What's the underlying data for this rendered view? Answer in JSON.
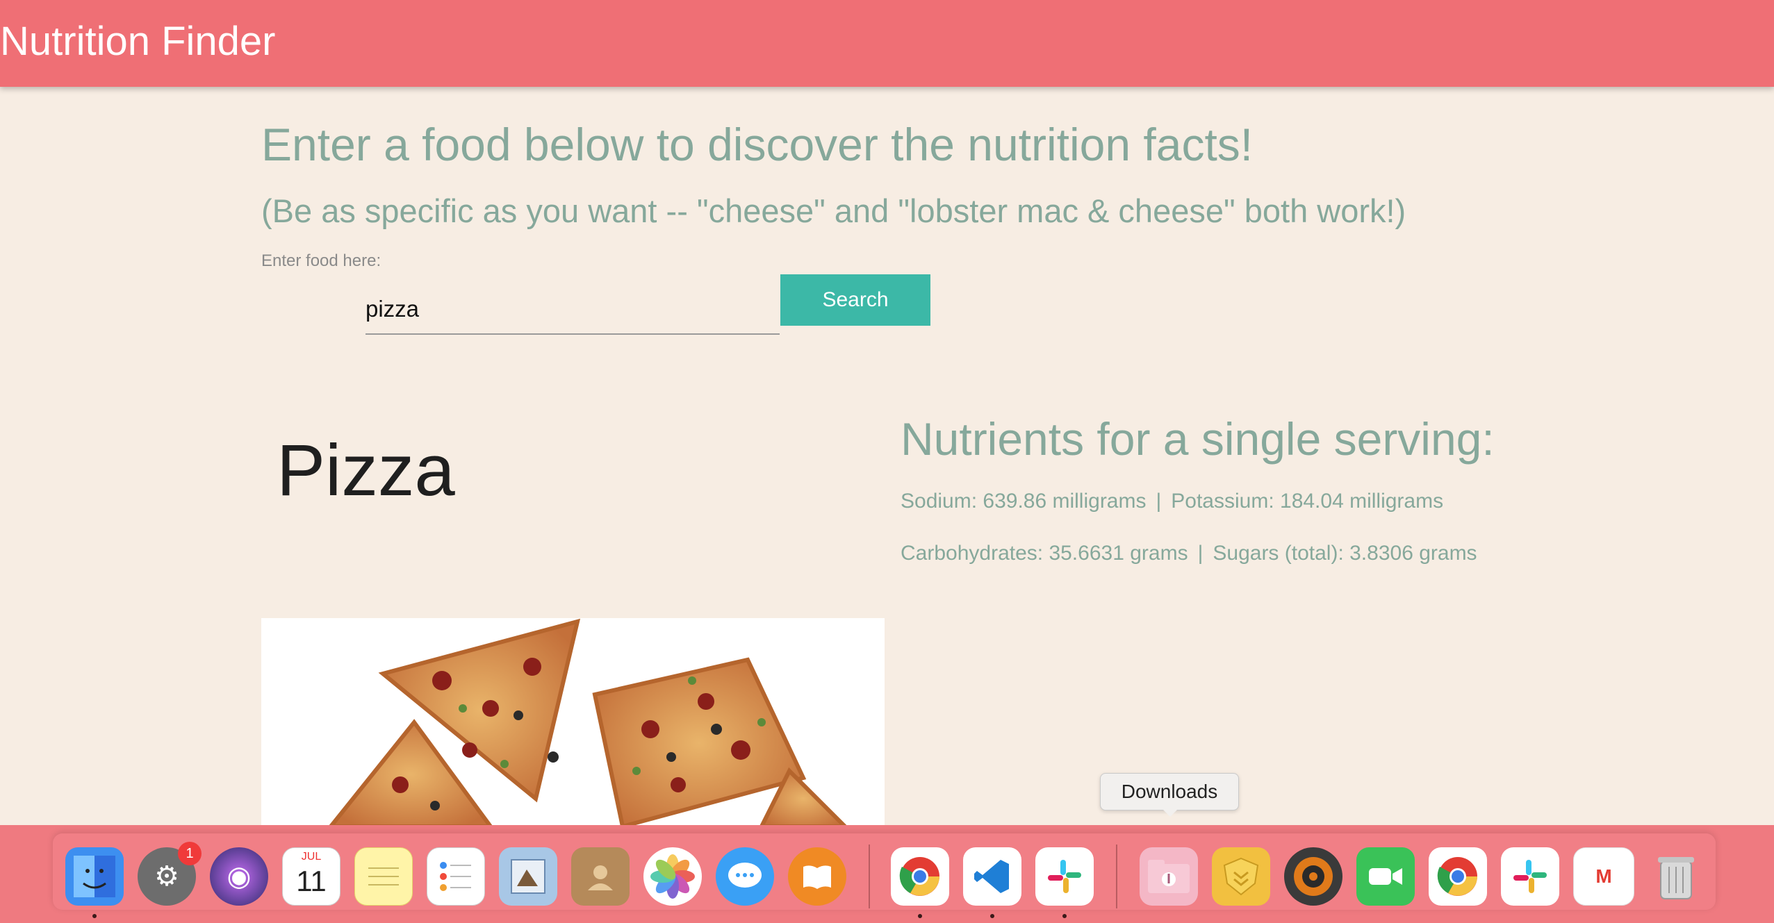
{
  "navbar": {
    "brand": "Nutrition Finder"
  },
  "main": {
    "headline": "Enter a food below to discover the nutrition facts!",
    "subline": "(Be as specific as you want -- \"cheese\" and \"lobster mac & cheese\" both work!)",
    "input_label": "Enter food here:",
    "input_value": "pizza",
    "search_label": "Search"
  },
  "result": {
    "food_name": "Pizza",
    "nutrients_title": "Nutrients for a single serving:",
    "sodium": "Sodium: 639.86 milligrams",
    "potassium": "Potassium: 184.04 milligrams",
    "carbohydrates": "Carbohydrates: 35.6631 grams",
    "sugars": "Sugars (total): 3.8306 grams",
    "separator": "|"
  },
  "dock": {
    "tooltip": "Downloads",
    "calendar_month": "JUL",
    "calendar_day": "11",
    "settings_badge": "1",
    "gmail_letter": "M",
    "items": [
      {
        "name": "Finder",
        "icon": "finder-icon",
        "color": "#3d8ff0"
      },
      {
        "name": "System Preferences",
        "icon": "gear-icon",
        "color": "#7d7d7d"
      },
      {
        "name": "Siri",
        "icon": "siri-icon",
        "color": "#3b2d7a"
      },
      {
        "name": "Calendar",
        "icon": "calendar-icon",
        "color": "#ffffff"
      },
      {
        "name": "Notes",
        "icon": "notes-icon",
        "color": "#fff4a8"
      },
      {
        "name": "Reminders",
        "icon": "reminders-icon",
        "color": "#ffffff"
      },
      {
        "name": "Preview",
        "icon": "preview-icon",
        "color": "#a8c7e6"
      },
      {
        "name": "Contacts",
        "icon": "contacts-icon",
        "color": "#b58a5a"
      },
      {
        "name": "Photos",
        "icon": "photos-icon",
        "color": "#ffffff"
      },
      {
        "name": "Messages",
        "icon": "messages-icon",
        "color": "#3aa0f5"
      },
      {
        "name": "Books",
        "icon": "books-icon",
        "color": "#f08a24"
      },
      {
        "name": "Chrome",
        "icon": "chrome-icon",
        "color": "#ffffff"
      },
      {
        "name": "VS Code",
        "icon": "vscode-icon",
        "color": "#ffffff"
      },
      {
        "name": "Slack",
        "icon": "slack-icon",
        "color": "#ffffff"
      },
      {
        "name": "Downloads",
        "icon": "downloads-folder-icon",
        "color": "#f4b7c6"
      },
      {
        "name": "Tunnelblick",
        "icon": "shield-icon",
        "color": "#f2c040"
      },
      {
        "name": "Speaker",
        "icon": "speaker-icon",
        "color": "#e07a1a"
      },
      {
        "name": "FaceTime",
        "icon": "facetime-icon",
        "color": "#3ac258"
      },
      {
        "name": "Chrome 2",
        "icon": "chrome-icon",
        "color": "#ffffff"
      },
      {
        "name": "Slack 2",
        "icon": "slack-icon",
        "color": "#ffffff"
      },
      {
        "name": "Gmail",
        "icon": "gmail-icon",
        "color": "#ffffff"
      },
      {
        "name": "Trash",
        "icon": "trash-icon",
        "color": "#dcdcdc"
      }
    ]
  }
}
